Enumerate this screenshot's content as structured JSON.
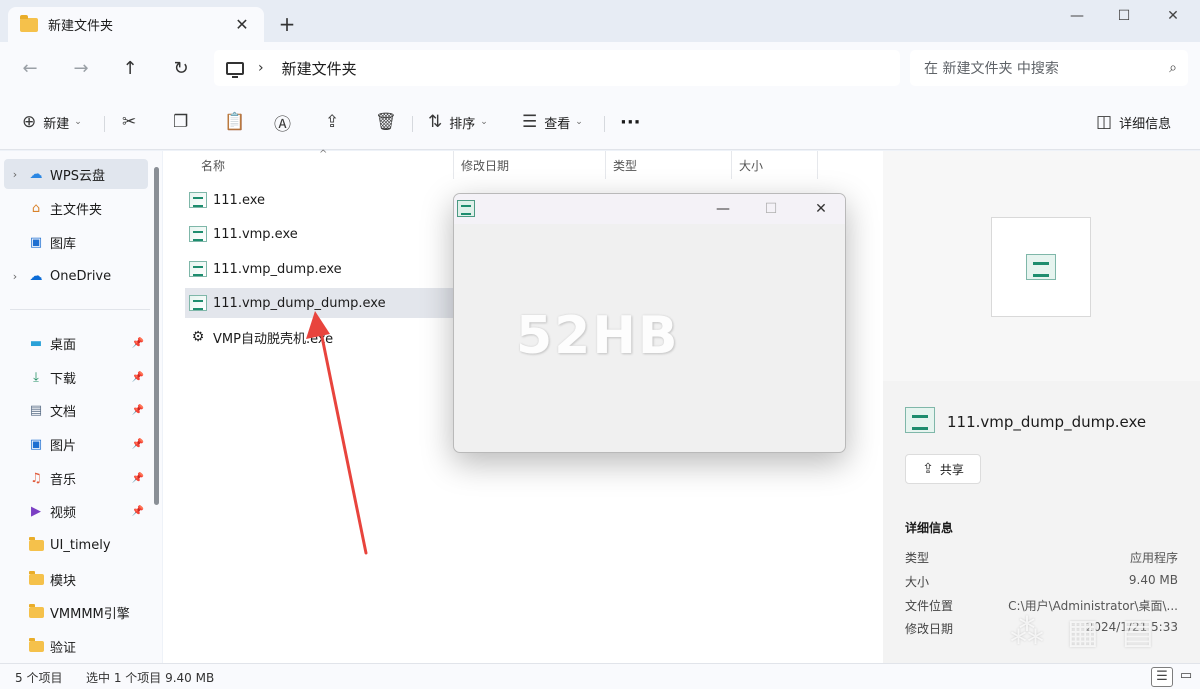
{
  "tab": {
    "title": "新建文件夹"
  },
  "window_controls": {
    "minimize": "—",
    "maximize": "☐",
    "close": "✕"
  },
  "nav": {
    "back": "←",
    "forward": "→",
    "up": "↑",
    "refresh": "↻"
  },
  "address": {
    "path": "新建文件夹"
  },
  "search": {
    "placeholder": "在 新建文件夹 中搜索"
  },
  "toolbar": {
    "new_label": "新建",
    "sort_label": "排序",
    "view_label": "查看",
    "more_label": "···",
    "details_label": "详细信息"
  },
  "sidebar": {
    "items": [
      {
        "label": "WPS云盘",
        "icon": "cloud-icon",
        "pinned": false
      },
      {
        "label": "主文件夹",
        "icon": "home-icon",
        "pinned": false
      },
      {
        "label": "图库",
        "icon": "gallery-icon",
        "pinned": false
      },
      {
        "label": "OneDrive",
        "icon": "onedrive-icon",
        "pinned": false
      },
      {
        "label": "桌面",
        "icon": "desktop-icon",
        "pinned": true
      },
      {
        "label": "下载",
        "icon": "download-icon",
        "pinned": true
      },
      {
        "label": "文档",
        "icon": "document-icon",
        "pinned": true
      },
      {
        "label": "图片",
        "icon": "picture-icon",
        "pinned": true
      },
      {
        "label": "音乐",
        "icon": "music-icon",
        "pinned": true
      },
      {
        "label": "视频",
        "icon": "video-icon",
        "pinned": true
      },
      {
        "label": "UI_timely",
        "icon": "folder-icon",
        "pinned": false
      },
      {
        "label": "模块",
        "icon": "folder-icon",
        "pinned": false
      },
      {
        "label": "VMMMM引擎",
        "icon": "folder-icon",
        "pinned": false
      },
      {
        "label": "验证",
        "icon": "folder-icon",
        "pinned": false
      }
    ]
  },
  "columns": {
    "name": "名称",
    "modified": "修改日期",
    "type": "类型",
    "size": "大小"
  },
  "files": [
    {
      "name": "111.exe"
    },
    {
      "name": "111.vmp.exe"
    },
    {
      "name": "111.vmp_dump.exe"
    },
    {
      "name": "111.vmp_dump_dump.exe"
    },
    {
      "name": "VMP自动脱壳机.exe"
    }
  ],
  "popup": {
    "watermark": "52HB"
  },
  "detail": {
    "filename": "111.vmp_dump_dump.exe",
    "share_label": "共享",
    "section_title": "详细信息",
    "props": [
      {
        "label": "类型",
        "value": "应用程序"
      },
      {
        "label": "大小",
        "value": "9.40 MB"
      },
      {
        "label": "文件位置",
        "value": "C:\\用户\\Administrator\\桌面\\..."
      },
      {
        "label": "修改日期",
        "value": "2024/1/21 5:33"
      }
    ]
  },
  "status": {
    "count": "5 个项目",
    "selection": "选中 1 个项目  9.40 MB"
  },
  "colors": {
    "accent_arrow": "#e8443d",
    "selection": "#e3e6ec",
    "folder": "#f5c14b"
  }
}
